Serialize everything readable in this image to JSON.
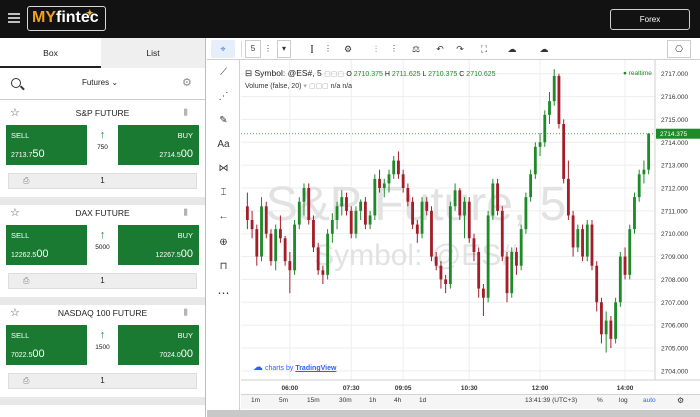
{
  "header": {
    "logo_my": "MY",
    "logo_rest": "fintec",
    "market_select": "Forex"
  },
  "left_panel": {
    "tabs": [
      "Box",
      "List"
    ],
    "filter": {
      "selected": "Futures"
    },
    "instruments": [
      {
        "name": "S&P FUTURE",
        "sell_label": "SELL",
        "sell_small": "2713.7",
        "sell_big": "50",
        "buy_label": "BUY",
        "buy_small": "2714.5",
        "buy_big": "00",
        "spread": "750",
        "qty": "1"
      },
      {
        "name": "DAX FUTURE",
        "sell_label": "SELL",
        "sell_small": "12262.5",
        "sell_big": "00",
        "buy_label": "BUY",
        "buy_small": "12267.5",
        "buy_big": "00",
        "spread": "5000",
        "qty": "1"
      },
      {
        "name": "NASDAQ 100 FUTURE",
        "sell_label": "SELL",
        "sell_small": "7022.5",
        "sell_big": "00",
        "buy_label": "BUY",
        "buy_small": "7024.0",
        "buy_big": "00",
        "spread": "1500",
        "qty": "1"
      }
    ]
  },
  "chart_toolbar": {
    "interval": "5"
  },
  "chart_legend": {
    "symbol": "Symbol: @ES#, 5",
    "o_label": "O",
    "o": "2710.375",
    "h_label": "H",
    "h": "2711.625",
    "l_label": "L",
    "l": "2710.375",
    "c_label": "C",
    "c": "2710.625",
    "realtime": "realtime",
    "volume": "Volume (false, 20)",
    "na1": "n/a",
    "na2": "n/a"
  },
  "watermark": {
    "line1": "S&P Future, 5",
    "line2": "Symbol: @ES#"
  },
  "attribution": {
    "prefix": "charts by",
    "brand": "TradingView"
  },
  "bottom_bar": {
    "ranges": [
      "1m",
      "5m",
      "15m",
      "30m",
      "1h",
      "4h",
      "1d"
    ],
    "clock": "13:41:39 (UTC+3)",
    "percent": "%",
    "log": "log",
    "auto": "auto"
  },
  "chart_data": {
    "type": "candlestick",
    "title": "Symbol: @ES#, 5",
    "x_tick_labels": [
      "06:00",
      "07:30",
      "09:05",
      "10:30",
      "12:00",
      "14:00"
    ],
    "y_tick_labels": [
      "2717.000",
      "2716.000",
      "2715.000",
      "2714.000",
      "2713.000",
      "2712.000",
      "2711.000",
      "2710.000",
      "2709.000",
      "2708.000",
      "2707.000",
      "2706.000",
      "2705.000",
      "2704.000"
    ],
    "ylim": [
      2703.6,
      2717.6
    ],
    "last_price": 2714.375,
    "last_price_label": "2714.375",
    "grid": true,
    "up_color": "#1f8a2a",
    "down_color": "#a31e2a",
    "candles": [
      [
        2711.2,
        2711.8,
        2710.2,
        2710.6
      ],
      [
        2710.6,
        2711.0,
        2709.8,
        2710.2
      ],
      [
        2710.2,
        2710.4,
        2708.6,
        2709.0
      ],
      [
        2709.0,
        2711.6,
        2708.8,
        2711.2
      ],
      [
        2711.2,
        2711.4,
        2709.8,
        2710.0
      ],
      [
        2710.0,
        2710.2,
        2708.6,
        2708.8
      ],
      [
        2708.8,
        2710.4,
        2708.4,
        2710.2
      ],
      [
        2710.2,
        2710.8,
        2709.6,
        2709.8
      ],
      [
        2709.8,
        2709.9,
        2708.6,
        2708.8
      ],
      [
        2708.8,
        2709.2,
        2707.4,
        2708.4
      ],
      [
        2708.4,
        2710.6,
        2708.2,
        2710.4
      ],
      [
        2710.4,
        2711.6,
        2710.2,
        2711.4
      ],
      [
        2711.4,
        2712.2,
        2710.8,
        2712.0
      ],
      [
        2712.0,
        2712.2,
        2710.4,
        2710.6
      ],
      [
        2710.6,
        2710.8,
        2709.2,
        2709.4
      ],
      [
        2709.4,
        2709.6,
        2708.2,
        2708.4
      ],
      [
        2708.4,
        2708.6,
        2707.8,
        2708.2
      ],
      [
        2708.2,
        2710.2,
        2708.0,
        2710.0
      ],
      [
        2710.0,
        2710.9,
        2709.6,
        2710.6
      ],
      [
        2710.6,
        2711.4,
        2710.2,
        2711.2
      ],
      [
        2711.2,
        2711.9,
        2710.8,
        2711.6
      ],
      [
        2711.6,
        2711.8,
        2710.8,
        2711.0
      ],
      [
        2711.0,
        2711.2,
        2709.8,
        2710.0
      ],
      [
        2710.0,
        2711.2,
        2709.8,
        2711.0
      ],
      [
        2711.0,
        2711.5,
        2710.6,
        2711.4
      ],
      [
        2711.4,
        2711.6,
        2710.2,
        2710.4
      ],
      [
        2710.4,
        2711.0,
        2710.2,
        2710.8
      ],
      [
        2710.8,
        2712.6,
        2710.6,
        2712.4
      ],
      [
        2712.4,
        2712.8,
        2711.8,
        2712.0
      ],
      [
        2712.0,
        2712.4,
        2711.6,
        2712.2
      ],
      [
        2712.2,
        2712.8,
        2711.8,
        2712.6
      ],
      [
        2712.6,
        2713.4,
        2712.4,
        2713.2
      ],
      [
        2713.2,
        2713.6,
        2712.4,
        2712.6
      ],
      [
        2712.6,
        2712.8,
        2711.8,
        2712.0
      ],
      [
        2712.0,
        2712.2,
        2711.2,
        2711.4
      ],
      [
        2711.4,
        2711.6,
        2710.2,
        2710.4
      ],
      [
        2710.4,
        2710.6,
        2709.6,
        2710.0
      ],
      [
        2710.0,
        2711.6,
        2709.8,
        2711.4
      ],
      [
        2711.4,
        2711.6,
        2710.8,
        2711.0
      ],
      [
        2711.0,
        2711.2,
        2708.8,
        2709.0
      ],
      [
        2709.0,
        2709.2,
        2708.4,
        2708.6
      ],
      [
        2708.6,
        2708.8,
        2707.6,
        2708.0
      ],
      [
        2708.0,
        2708.2,
        2707.4,
        2707.8
      ],
      [
        2707.8,
        2711.4,
        2707.6,
        2711.2
      ],
      [
        2711.2,
        2712.2,
        2711.0,
        2711.9
      ],
      [
        2711.9,
        2712.0,
        2710.6,
        2710.8
      ],
      [
        2710.8,
        2711.6,
        2709.8,
        2711.4
      ],
      [
        2711.4,
        2711.6,
        2709.6,
        2709.8
      ],
      [
        2709.8,
        2710.0,
        2708.8,
        2709.2
      ],
      [
        2709.2,
        2709.4,
        2707.2,
        2707.6
      ],
      [
        2707.6,
        2707.8,
        2706.4,
        2707.2
      ],
      [
        2707.2,
        2711.0,
        2707.0,
        2710.8
      ],
      [
        2710.8,
        2712.4,
        2710.6,
        2712.2
      ],
      [
        2712.2,
        2712.4,
        2710.8,
        2711.0
      ],
      [
        2711.0,
        2711.2,
        2708.8,
        2709.0
      ],
      [
        2709.0,
        2709.2,
        2707.0,
        2707.4
      ],
      [
        2707.4,
        2709.4,
        2707.2,
        2709.2
      ],
      [
        2709.2,
        2709.4,
        2708.2,
        2708.6
      ],
      [
        2708.6,
        2710.4,
        2708.4,
        2710.2
      ],
      [
        2710.2,
        2711.8,
        2710.0,
        2711.6
      ],
      [
        2711.6,
        2712.8,
        2711.4,
        2712.6
      ],
      [
        2712.6,
        2714.0,
        2712.4,
        2713.8
      ],
      [
        2713.8,
        2714.4,
        2713.4,
        2714.0
      ],
      [
        2714.0,
        2715.4,
        2713.8,
        2715.2
      ],
      [
        2715.2,
        2716.2,
        2714.8,
        2715.8
      ],
      [
        2715.8,
        2717.2,
        2715.6,
        2716.9
      ],
      [
        2716.9,
        2717.0,
        2714.6,
        2714.8
      ],
      [
        2714.8,
        2715.0,
        2712.2,
        2712.4
      ],
      [
        2712.4,
        2713.2,
        2710.6,
        2710.8
      ],
      [
        2710.8,
        2711.0,
        2709.0,
        2709.4
      ],
      [
        2709.4,
        2710.4,
        2709.2,
        2710.2
      ],
      [
        2710.2,
        2710.4,
        2708.8,
        2709.0
      ],
      [
        2709.0,
        2710.6,
        2708.8,
        2710.4
      ],
      [
        2710.4,
        2710.6,
        2708.4,
        2708.6
      ],
      [
        2708.6,
        2708.8,
        2706.6,
        2707.0
      ],
      [
        2707.0,
        2707.2,
        2705.2,
        2705.6
      ],
      [
        2705.6,
        2706.6,
        2704.8,
        2706.2
      ],
      [
        2706.2,
        2706.4,
        2705.0,
        2705.4
      ],
      [
        2705.4,
        2707.2,
        2705.2,
        2707.0
      ],
      [
        2707.0,
        2709.2,
        2706.8,
        2709.0
      ],
      [
        2709.0,
        2709.4,
        2708.0,
        2708.2
      ],
      [
        2708.2,
        2710.4,
        2708.0,
        2710.2
      ],
      [
        2710.2,
        2711.8,
        2710.0,
        2711.6
      ],
      [
        2711.6,
        2712.8,
        2711.4,
        2712.6
      ],
      [
        2712.6,
        2713.2,
        2712.2,
        2712.8
      ],
      [
        2712.8,
        2714.4,
        2712.6,
        2714.375
      ]
    ]
  },
  "colors": {
    "buy_sell_green": "#1a7a32",
    "top_bar": "#121212",
    "logo_accent": "#f0a020"
  }
}
